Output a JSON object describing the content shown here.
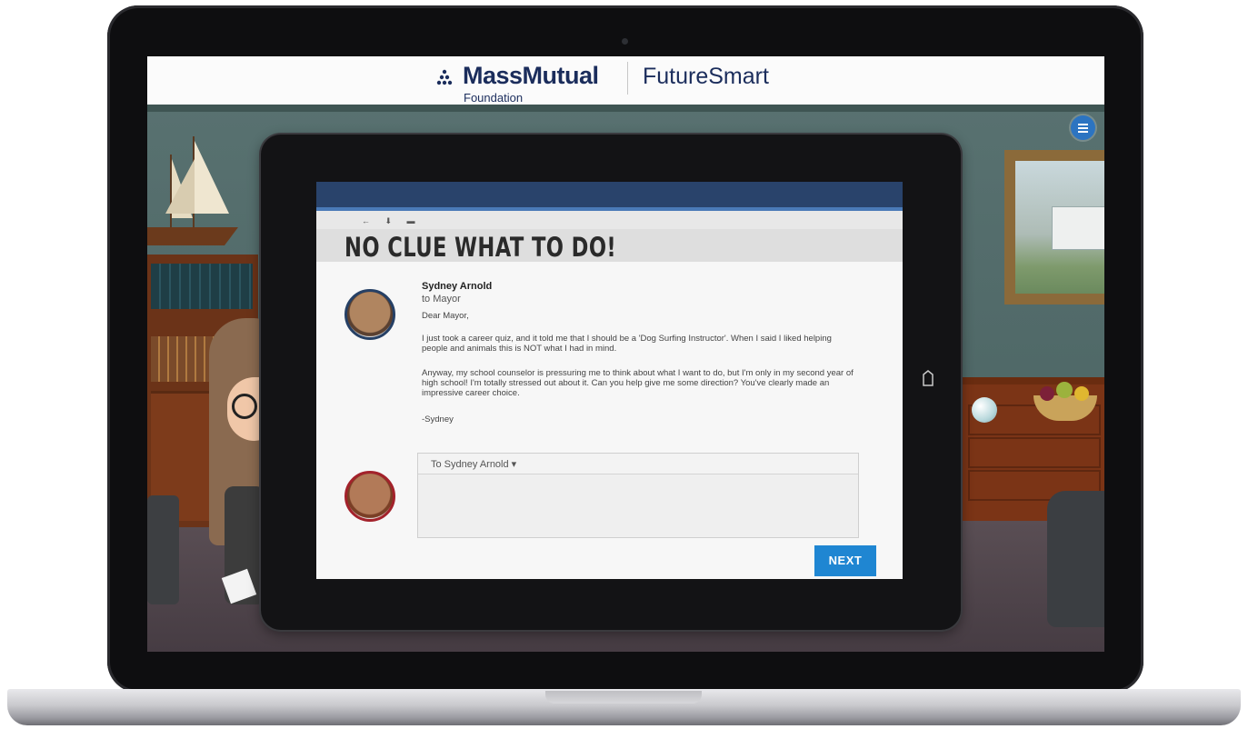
{
  "header": {
    "brand_name": "MassMutual",
    "brand_sub": "Foundation",
    "product_name": "FutureSmart"
  },
  "menu": {
    "icon": "hamburger-menu-icon"
  },
  "message": {
    "title": "NO CLUE WHAT TO DO!",
    "toolbar_icons": "← ⬇ ▬",
    "sender_name": "Sydney Arnold",
    "recipient": "to Mayor",
    "greeting": "Dear Mayor,",
    "paragraph1": "I just took a career quiz, and it told me that I should be a 'Dog Surfing Instructor'. When I said I liked helping people and animals this is NOT what I had in mind.",
    "paragraph2": "Anyway, my school counselor is pressuring me to think about what I want to do, but I'm only in my second year of high school! I'm totally stressed out about it. Can you help give me some direction? You've clearly made an impressive career choice.",
    "signoff": "-Sydney"
  },
  "reply": {
    "to_label": "To Sydney Arnold ▾",
    "body": ""
  },
  "actions": {
    "next_label": "NEXT"
  },
  "colors": {
    "brand_navy": "#1b2d5c",
    "next_button": "#1f86d2",
    "app_topbar": "#29436b",
    "menu_button": "#2c74c1"
  }
}
